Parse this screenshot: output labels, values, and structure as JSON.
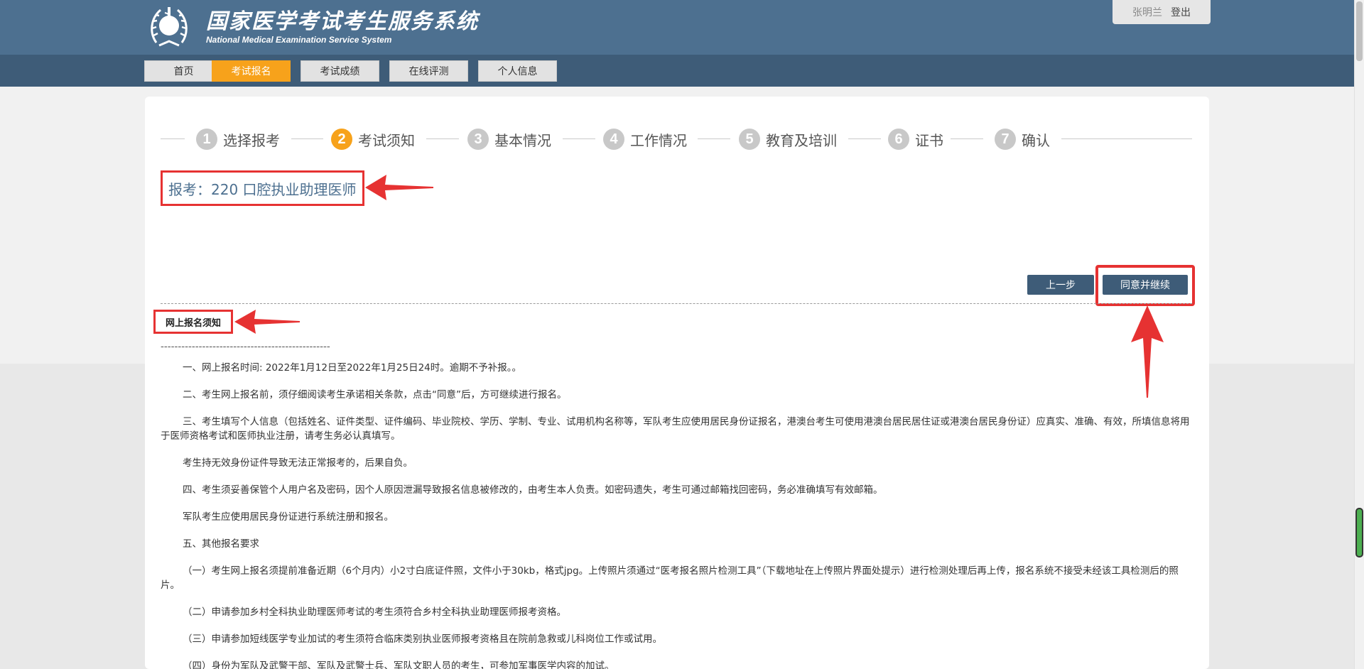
{
  "header": {
    "site_title_cn": "国家医学考试考生服务系统",
    "site_title_en": "National Medical Examination Service System",
    "user_name": "张明兰",
    "logout_label": "登出",
    "colors": {
      "header_bg": "#4d7090",
      "nav_bg": "#3e5c78",
      "accent": "#f7a21b",
      "annotation_red": "#e63232"
    }
  },
  "nav": {
    "items": [
      {
        "label": "首页"
      },
      {
        "label": "考试报名",
        "active": true
      },
      {
        "label": "考试成绩"
      },
      {
        "label": "在线评测"
      },
      {
        "label": "个人信息"
      }
    ]
  },
  "steps": [
    {
      "num": "1",
      "label": "选择报考"
    },
    {
      "num": "2",
      "label": "考试须知",
      "active": true
    },
    {
      "num": "3",
      "label": "基本情况"
    },
    {
      "num": "4",
      "label": "工作情况"
    },
    {
      "num": "5",
      "label": "教育及培训"
    },
    {
      "num": "6",
      "label": "证书"
    },
    {
      "num": "7",
      "label": "确认"
    }
  ],
  "exam": {
    "title": "报考：220 口腔执业助理医师"
  },
  "buttons": {
    "prev_label": "上一步",
    "agree_label": "同意并继续"
  },
  "notice": {
    "title": "网上报名须知",
    "separator": "-------------------------------------------------",
    "paragraphs": [
      "一、网上报名时间: 2022年1月12日至2022年1月25日24时。逾期不予补报。。",
      "二、考生网上报名前，须仔细阅读考生承诺相关条款，点击“同意”后，方可继续进行报名。",
      "三、考生填写个人信息（包括姓名、证件类型、证件编码、毕业院校、学历、学制、专业、试用机构名称等，军队考生应使用居民身份证报名，港澳台考生可使用港澳台居民居住证或港澳台居民身份证）应真实、准确、有效，所填信息将用于医师资格考试和医师执业注册，请考生务必认真填写。",
      "考生持无效身份证件导致无法正常报考的，后果自负。",
      "四、考生须妥善保管个人用户名及密码，因个人原因泄漏导致报名信息被修改的，由考生本人负责。如密码遗失，考生可通过邮箱找回密码，务必准确填写有效邮箱。",
      "军队考生应使用居民身份证进行系统注册和报名。",
      "五、其他报名要求",
      "（一）考生网上报名须提前准备近期（6个月内）小2寸白底证件照，文件小于30kb，格式jpg。上传照片须通过“医考报名照片检测工具”（下载地址在上传照片界面处提示）进行检测处理后再上传，报名系统不接受未经该工具检测后的照片。",
      "（二）申请参加乡村全科执业助理医师考试的考生须符合乡村全科执业助理医师报考资格。",
      "（三）申请参加短线医学专业加试的考生须符合临床类别执业医师报考资格且在院前急救或儿科岗位工作或试用。",
      "（四）身份为军队及武警干部、军队及武警士兵、军队文职人员的考生，可参加军事医学内容的加试。"
    ]
  }
}
